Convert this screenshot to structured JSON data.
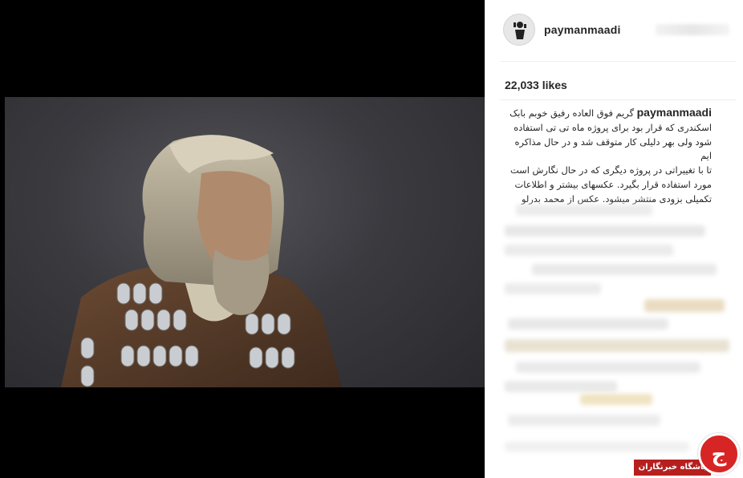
{
  "post": {
    "username": "paymanmaadi",
    "likes": "22,033 likes",
    "caption_author": "paymanmaadi",
    "caption_lines": [
      "گریم فوق العاده رفیق خوبم بابک",
      "اسکندری که قرار بود برای پروژه ماه تی تی استفاده",
      "شود ولی بهر دلیلی کار متوقف شد و در حال مذاکره ایم",
      "تا با تغییراتی در پروژه دیگری که در حال نگارش است",
      "مورد استفاده قرار بگیرد. عکسهای بیشتر و اطلاعات",
      "تکمیلی بزودی منتشر میشود. عکس از محمد بدرلو"
    ]
  },
  "watermark": {
    "text": "باشگاه خبرنگاران",
    "logo_char": "ج"
  },
  "colors": {
    "text": "#262626",
    "divider": "#efefef",
    "badge_red": "#d72525"
  },
  "icons": [
    "avatar-figure-icon",
    "watermark-logo-icon"
  ]
}
